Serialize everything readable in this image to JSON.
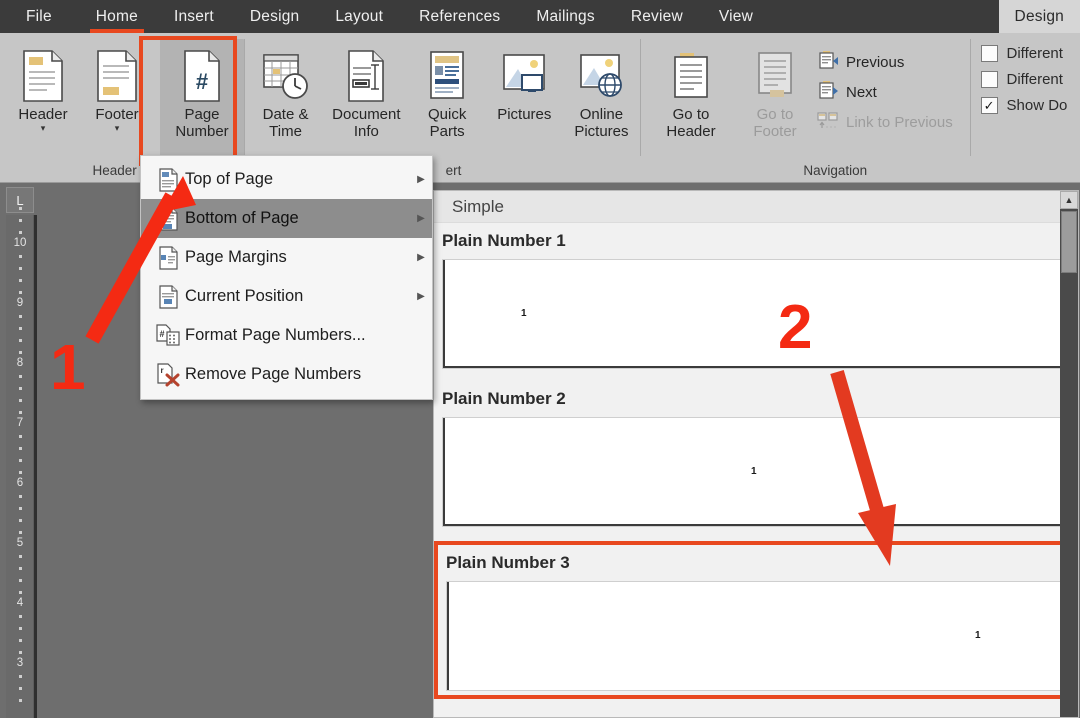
{
  "window": {
    "tabs": [
      {
        "label": "File",
        "state": "file"
      },
      {
        "label": "Home",
        "state": "active"
      },
      {
        "label": "Insert",
        "state": "normal"
      },
      {
        "label": "Design",
        "state": "normal"
      },
      {
        "label": "Layout",
        "state": "normal"
      },
      {
        "label": "References",
        "state": "normal"
      },
      {
        "label": "Mailings",
        "state": "normal"
      },
      {
        "label": "Review",
        "state": "normal"
      },
      {
        "label": "View",
        "state": "normal"
      }
    ],
    "contextual_tab": "Design"
  },
  "ribbon": {
    "groups": [
      {
        "name": "header-footer",
        "label": "Header & F"
      },
      {
        "name": "insert",
        "label": "ert"
      },
      {
        "name": "navigation",
        "label": "Navigation"
      },
      {
        "name": "options",
        "label": ""
      }
    ],
    "header_footer": {
      "label": "Header & F",
      "buttons": [
        {
          "name": "header",
          "caption": "Header",
          "caret": true,
          "icon": "header-page-icon"
        },
        {
          "name": "footer",
          "caption": "Footer",
          "caret": true,
          "icon": "footer-page-icon"
        },
        {
          "name": "page-number",
          "caption": "Page\nNumber",
          "caret": true,
          "icon": "page-number-icon",
          "highlighted": true,
          "pressed": true
        }
      ]
    },
    "insert": {
      "label": "ert",
      "buttons": [
        {
          "name": "date-time",
          "caption": "Date &\nTime",
          "caret": false,
          "icon": "calendar-clock-icon"
        },
        {
          "name": "document-info",
          "caption": "Document\nInfo",
          "caret": true,
          "icon": "document-info-icon"
        },
        {
          "name": "quick-parts",
          "caption": "Quick\nParts",
          "caret": true,
          "icon": "quick-parts-icon"
        },
        {
          "name": "pictures",
          "caption": "Pictures",
          "caret": false,
          "icon": "pictures-icon"
        },
        {
          "name": "online-pictures",
          "caption": "Online\nPictures",
          "caret": false,
          "icon": "online-pictures-icon"
        }
      ]
    },
    "navigation": {
      "label": "Navigation",
      "buttons": [
        {
          "name": "go-to-header",
          "caption": "Go to\nHeader",
          "icon": "go-to-header-icon",
          "disabled": false
        },
        {
          "name": "go-to-footer",
          "caption": "Go to\nFooter",
          "icon": "go-to-footer-icon",
          "disabled": true
        }
      ],
      "small_items": [
        {
          "name": "previous",
          "label": "Previous",
          "icon": "previous-section-icon",
          "disabled": false
        },
        {
          "name": "next",
          "label": "Next",
          "icon": "next-section-icon",
          "disabled": false
        },
        {
          "name": "link-to-previous",
          "label": "Link to Previous",
          "icon": "link-to-previous-icon",
          "disabled": true
        }
      ]
    },
    "options": {
      "checkboxes": [
        {
          "name": "different-first-page",
          "label": "Different",
          "checked": false
        },
        {
          "name": "different-odd-even",
          "label": "Different",
          "checked": false
        },
        {
          "name": "show-document-text",
          "label": "Show Do",
          "checked": true
        }
      ]
    }
  },
  "menu": {
    "name": "page-number-menu",
    "items": [
      {
        "name": "top-of-page",
        "label": "Top of Page",
        "accel": "T",
        "submenu": true,
        "selected": false,
        "icon": "top-of-page-icon"
      },
      {
        "name": "bottom-of-page",
        "label": "Bottom of Page",
        "accel": "B",
        "submenu": true,
        "selected": true,
        "icon": "bottom-of-page-icon"
      },
      {
        "name": "page-margins",
        "label": "Page Margins",
        "accel": "P",
        "submenu": true,
        "selected": false,
        "icon": "page-margins-icon"
      },
      {
        "name": "current-position",
        "label": "Current Position",
        "accel": "C",
        "submenu": true,
        "selected": false,
        "icon": "current-position-icon"
      },
      {
        "name": "format-page-numbers",
        "label": "Format Page Numbers...",
        "accel": "F",
        "submenu": false,
        "selected": false,
        "icon": "format-page-numbers-icon"
      },
      {
        "name": "remove-page-numbers",
        "label": "Remove Page Numbers",
        "accel": "R",
        "submenu": false,
        "selected": false,
        "icon": "remove-page-numbers-icon"
      }
    ]
  },
  "gallery": {
    "section_header": "Simple",
    "scrollbar": {
      "up_arrow": "▲"
    },
    "entries": [
      {
        "name": "plain-number-1",
        "title": "Plain Number 1",
        "page_number": "1",
        "align": "left",
        "selected": false
      },
      {
        "name": "plain-number-2",
        "title": "Plain Number 2",
        "page_number": "1",
        "align": "center",
        "selected": false
      },
      {
        "name": "plain-number-3",
        "title": "Plain Number 3",
        "page_number": "1",
        "align": "right",
        "selected": true
      }
    ]
  },
  "ruler": {
    "name": "vertical-ruler",
    "corner_label": "L",
    "ticks": [
      "10",
      "9",
      "8",
      "7",
      "6",
      "5",
      "4",
      "3"
    ]
  },
  "annotations": [
    {
      "name": "annotation-step-1",
      "label": "1"
    },
    {
      "name": "annotation-step-2",
      "label": "2"
    }
  ],
  "colors": {
    "accent_red": "#e8481f",
    "annotation_red": "#f42a13",
    "ribbon_bg": "#c6c6c6",
    "tabstrip_bg": "#3b3b3b",
    "doc_bg": "#6e6e6e"
  }
}
